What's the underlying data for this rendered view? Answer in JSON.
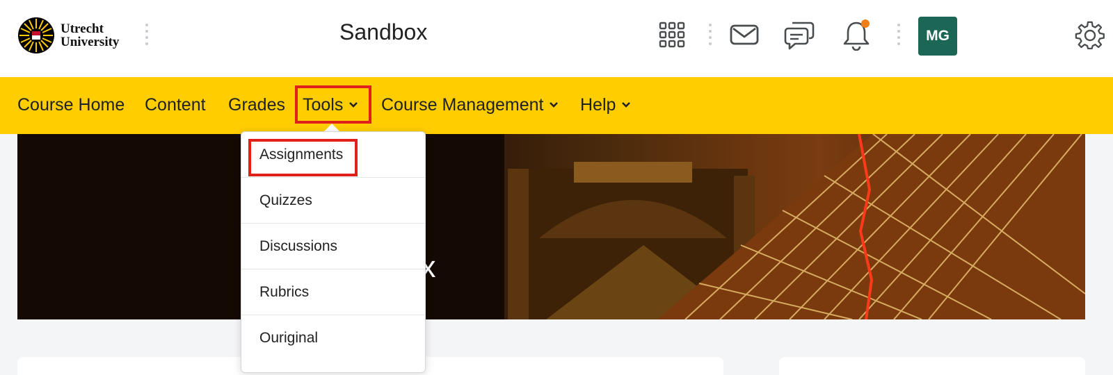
{
  "header": {
    "logo_line1": "Utrecht",
    "logo_line2": "University",
    "course_title": "Sandbox",
    "avatar_initials": "MG",
    "notification_dot_color": "#f07f1a",
    "avatar_color": "#1c6656"
  },
  "icons": {
    "apps": "grid-icon",
    "mail": "mail-icon",
    "chat": "chat-icon",
    "bell": "bell-icon",
    "settings": "gear-icon"
  },
  "nav": {
    "items": [
      {
        "label": "Course Home"
      },
      {
        "label": "Content"
      },
      {
        "label": "Grades"
      },
      {
        "label": "Tools"
      },
      {
        "label": "Course Management"
      },
      {
        "label": "Help"
      }
    ],
    "bar_color": "#ffcd00"
  },
  "banner": {
    "visible_text": "ox"
  },
  "dropdown": {
    "items": [
      {
        "label": "Assignments"
      },
      {
        "label": "Quizzes"
      },
      {
        "label": "Discussions"
      },
      {
        "label": "Rubrics"
      },
      {
        "label": "Ouriginal"
      }
    ]
  },
  "highlight_color": "#e0211b"
}
